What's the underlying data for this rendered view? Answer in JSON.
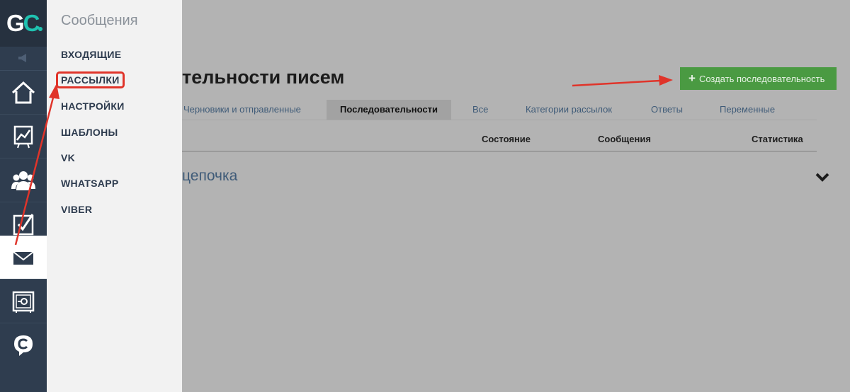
{
  "logo": {
    "text_g": "G",
    "text_c": "C"
  },
  "menu": {
    "title": "Сообщения",
    "items": [
      {
        "label": "ВХОДЯЩИЕ"
      },
      {
        "label": "РАССЫЛКИ"
      },
      {
        "label": "НАСТРОЙКИ"
      },
      {
        "label": "ШАБЛОНЫ"
      },
      {
        "label": "VK"
      },
      {
        "label": "WHATSAPP"
      },
      {
        "label": "VIBER"
      }
    ]
  },
  "page": {
    "title": "тельности писем",
    "create_button": "Создать последовательность",
    "create_button_icon": "+"
  },
  "tabs": [
    {
      "label": "Черновики и отправленные"
    },
    {
      "label": "Последовательности"
    },
    {
      "label": "Все"
    },
    {
      "label": "Категории рассылок"
    },
    {
      "label": "Ответы"
    },
    {
      "label": "Переменные"
    }
  ],
  "table": {
    "columns": [
      "Состояние",
      "Сообщения",
      "Статистика"
    ],
    "rows": [
      {
        "name": "цепочка"
      }
    ]
  },
  "colors": {
    "accent_green": "#4a9a42",
    "rail_bg": "#2f3d4f",
    "logo_teal": "#1fc2b0",
    "annotation_red": "#e0342a"
  },
  "icons": [
    "megaphone-icon",
    "home-icon",
    "chart-icon",
    "users-icon",
    "checkbox-icon",
    "mail-icon",
    "safe-icon",
    "chat-icon",
    "chevron-down-icon",
    "plus-icon"
  ]
}
